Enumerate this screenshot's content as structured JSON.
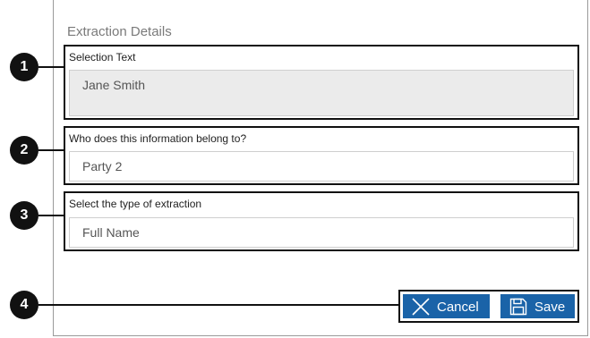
{
  "panel": {
    "title": "Extraction Details"
  },
  "sections": [
    {
      "label": "Selection Text",
      "value": "Jane Smith"
    },
    {
      "label": "Who does this information belong to?",
      "value": "Party 2"
    },
    {
      "label": "Select the type of extraction",
      "value": "Full Name"
    }
  ],
  "buttons": {
    "cancel": "Cancel",
    "save": "Save"
  },
  "callouts": [
    "1",
    "2",
    "3",
    "4"
  ],
  "colors": {
    "button_bg": "#1a63a8",
    "readonly_bg": "#ebebeb"
  }
}
